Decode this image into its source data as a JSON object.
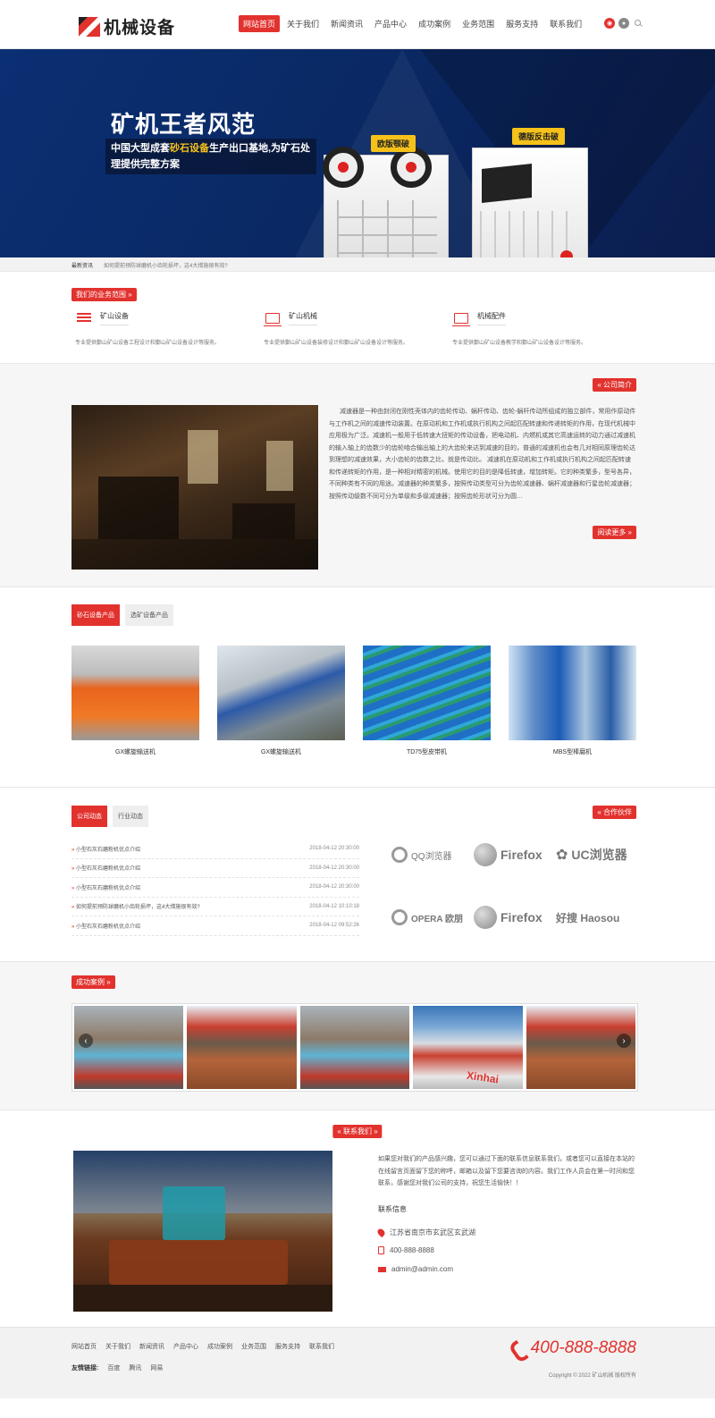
{
  "brand": {
    "name": "机械设备"
  },
  "nav": [
    {
      "label": "网站首页",
      "active": true
    },
    {
      "label": "关于我们"
    },
    {
      "label": "新闻资讯"
    },
    {
      "label": "产品中心"
    },
    {
      "label": "成功案例"
    },
    {
      "label": "业务范围"
    },
    {
      "label": "服务支持"
    },
    {
      "label": "联系我们"
    }
  ],
  "banner": {
    "title": "矿机王者风范",
    "subtitle_a": "中国大型成套",
    "subtitle_hl": "砂石设备",
    "subtitle_b": "生产出口基地,为矿石处理提供完整方案",
    "tag_left": "欧版颚破",
    "tag_right": "德版反击破"
  },
  "ticker": {
    "label": "最新资讯",
    "text": "如何提前预防球磨机小齿轮损坏，这4大措施很有效?"
  },
  "business": {
    "label": "我们的业务范围 »",
    "items": [
      {
        "title": "矿山设备",
        "desc": "专业提供鄞山矿山设备工程设计和鄞山矿山设备设计等服务。"
      },
      {
        "title": "矿山机械",
        "desc": "专业提供鄞山矿山设备装修设计和鄞山矿山设备设计等服务。"
      },
      {
        "title": "机械配件",
        "desc": "专业提供鄞山矿山设备教学和鄞山矿山设备设计等服务。"
      }
    ]
  },
  "about": {
    "label": "« 公司简介",
    "text": "减速器是一种由封闭在刚性壳体内的齿轮传动、蜗杆传动、齿轮-蜗杆传动所组成的独立部件，常用作原动件与工作机之间的减速传动装置。在原动机和工作机或执行机构之间起匹配转速和传递转矩的作用，在现代机械中应用极为广泛。减速机一般用于低转速大扭矩的传动设备，把电动机、内燃机或其它高速运转的动力通过减速机的输入轴上的齿数少的齿轮啮合输出轴上的大齿轮来达到减速的目的，普通的减速机也会有几对相同原理齿轮达到理想的减速效果，大小齿轮的齿数之比，就是传动比。 减速机在原动机和工作机或执行机构之间起匹配转速和传递转矩的作用，是一种相对精密的机械。使用它的目的是降低转速，增加转矩。它的种类繁多，型号各异，不同种类有不同的用途。减速器的种类繁多，按照传动类型可分为齿轮减速器、蜗杆减速器和行星齿轮减速器；按照传动级数不同可分为单级和多级减速器；按照齿轮形状可分为圆…",
    "more": "阅读更多 »"
  },
  "products": {
    "tabs": [
      {
        "label": "砂石设备产品",
        "active": true
      },
      {
        "label": "选矿设备产品"
      }
    ],
    "items": [
      {
        "name": "GX螺旋输送机"
      },
      {
        "name": "GX螺旋输送机"
      },
      {
        "name": "TD75型皮带机"
      },
      {
        "name": "MBS型棒磨机"
      }
    ]
  },
  "news": {
    "tabs": [
      {
        "label": "公司动态",
        "active": true
      },
      {
        "label": "行业动态"
      }
    ],
    "items": [
      {
        "title": "小型石灰石磨粉机优点介绍",
        "date": "2018-04-12 20:30:00"
      },
      {
        "title": "小型石灰石磨粉机优点介绍",
        "date": "2018-04-12 20:30:00"
      },
      {
        "title": "小型石灰石磨粉机优点介绍",
        "date": "2018-04-12 20:30:00"
      },
      {
        "title": "如何提前预防球磨机小齿轮损坏，这4大措施很有效?",
        "date": "2018-04-12 10:10:18"
      },
      {
        "title": "小型石灰石磨粉机优点介绍",
        "date": "2018-04-12 09:52:26"
      }
    ]
  },
  "partners": {
    "label": "« 合作伙伴",
    "items": [
      "QQ浏览器",
      "Firefox",
      "UC浏览器",
      "OPERA 欧朋",
      "Firefox",
      "好搜 Haosou"
    ]
  },
  "cases": {
    "label": "成功案例 »",
    "watermark": "Xinhai"
  },
  "contact": {
    "label": "« 联系我们 »",
    "intro": "如果您对我们的产品感兴趣，您可以通过下面的联系信息联系我们，或者您可以直接在本站的在线留言页面留下您的称呼，邮箱以及留下您要咨询的内容。我们工作人员会在第一时间和您联系，感谢您对我们公司的支持，祝您生活愉快！！",
    "heading": "联系信息",
    "address": "江苏省南京市玄武区玄武湖",
    "phone": "400-888-8888",
    "email": "admin@admin.com"
  },
  "footer": {
    "nav": [
      "网站首页",
      "关于我们",
      "新闻资讯",
      "产品中心",
      "成功案例",
      "业务范围",
      "服务支持",
      "联系我们"
    ],
    "links_label": "友情链接:",
    "links": [
      "百度",
      "腾讯",
      "网易"
    ],
    "phone": "400-888-8888",
    "copyright": "Copyright © 2022 矿山机械 版权所有"
  },
  "colors": {
    "accent": "#e2322e",
    "banner_bg": "#0b2f73",
    "highlight": "#f6c21a"
  }
}
